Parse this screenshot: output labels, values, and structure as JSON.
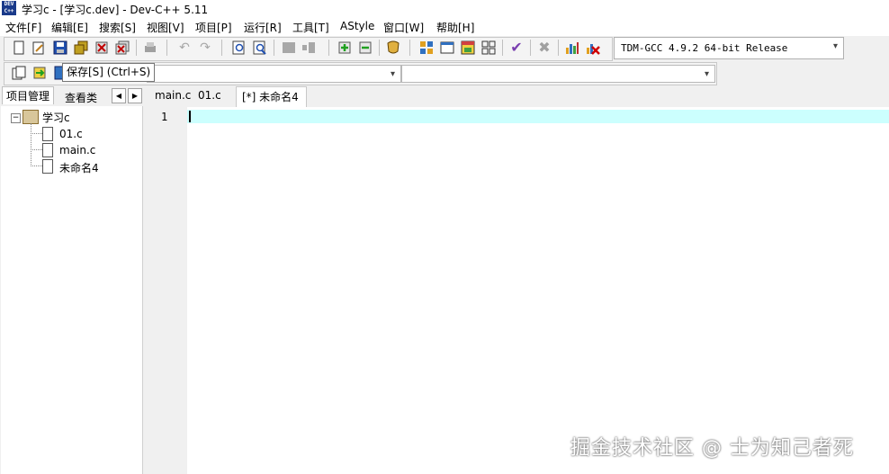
{
  "window": {
    "title": "学习c - [学习c.dev] - Dev-C++ 5.11",
    "logo_text": "DEV C++"
  },
  "menu": [
    "文件[F]",
    "编辑[E]",
    "搜索[S]",
    "视图[V]",
    "项目[P]",
    "运行[R]",
    "工具[T]",
    "AStyle",
    "窗口[W]",
    "帮助[H]"
  ],
  "toolbar": {
    "compiler_selected": "TDM-GCC 4.9.2 64-bit Release"
  },
  "tooltip": "保存[S] (Ctrl+S)",
  "left_panel": {
    "tabs": [
      "项目管理",
      "查看类"
    ],
    "tree": {
      "project": "学习c",
      "files": [
        "01.c",
        "main.c",
        "未命名4"
      ]
    }
  },
  "editor": {
    "tabs": [
      "main.c",
      "01.c",
      "[*] 未命名4"
    ],
    "active_tab_index": 2,
    "line_numbers": [
      "1"
    ]
  },
  "watermark": "掘金技术社区 @ 士为知己者死",
  "colors": {
    "current_line": "#ccfffe",
    "background": "#f0f0f0"
  }
}
